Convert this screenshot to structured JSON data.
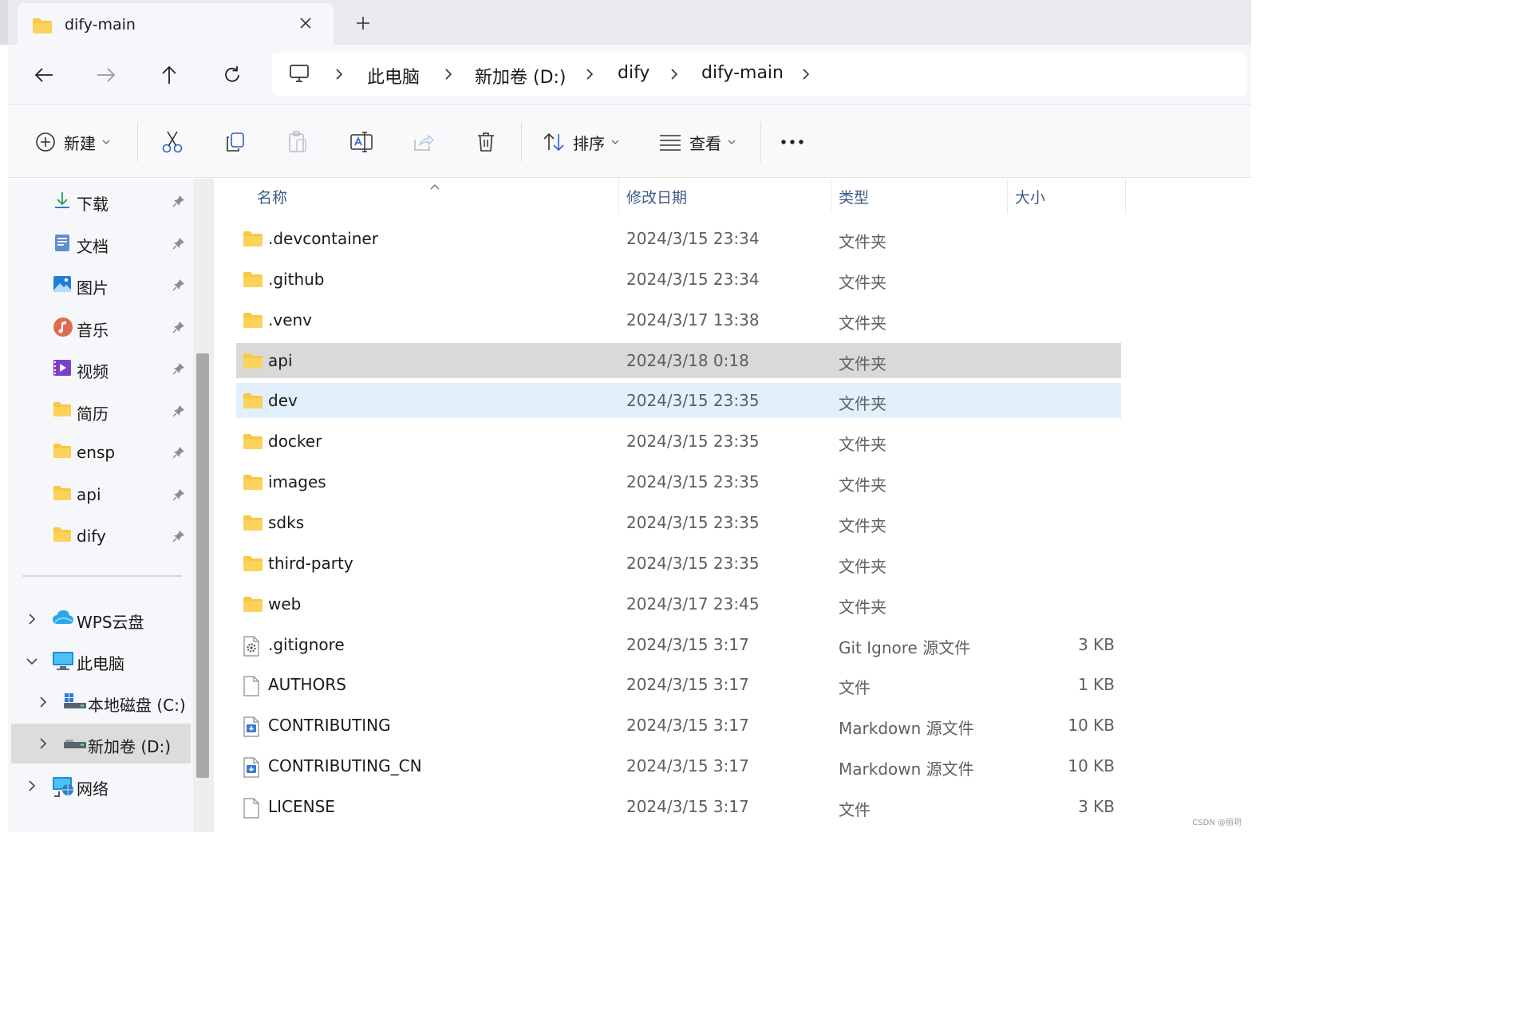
{
  "tab": {
    "title": "dify-main",
    "new_tab_symbol": "+"
  },
  "breadcrumb": [
    "此电脑",
    "新加卷 (D:)",
    "dify",
    "dify-main"
  ],
  "toolbar": {
    "new_label": "新建",
    "sort_label": "排序",
    "view_label": "查看"
  },
  "sidebar": {
    "quick_access": [
      {
        "label": "下载",
        "icon": "download-icon"
      },
      {
        "label": "文档",
        "icon": "documents-icon"
      },
      {
        "label": "图片",
        "icon": "pictures-icon"
      },
      {
        "label": "音乐",
        "icon": "music-icon"
      },
      {
        "label": "视频",
        "icon": "videos-icon"
      },
      {
        "label": "简历",
        "icon": "folder-icon"
      },
      {
        "label": "ensp",
        "icon": "folder-icon"
      },
      {
        "label": "api",
        "icon": "folder-icon"
      },
      {
        "label": "dify",
        "icon": "folder-icon"
      }
    ],
    "tree": [
      {
        "label": "WPS云盘",
        "icon": "cloud-icon",
        "expanded": false
      },
      {
        "label": "此电脑",
        "icon": "pc-icon",
        "expanded": true
      },
      {
        "label": "本地磁盘 (C:)",
        "icon": "drive-icon",
        "expanded": false
      },
      {
        "label": "新加卷 (D:)",
        "icon": "drive-icon",
        "expanded": false,
        "selected": true
      },
      {
        "label": "网络",
        "icon": "network-icon",
        "expanded": false
      }
    ]
  },
  "columns": {
    "name": "名称",
    "modified": "修改日期",
    "type": "类型",
    "size": "大小"
  },
  "files": [
    {
      "name": ".devcontainer",
      "date": "2024/3/15 23:34",
      "type": "文件夹",
      "size": "",
      "kind": "folder"
    },
    {
      "name": ".github",
      "date": "2024/3/15 23:34",
      "type": "文件夹",
      "size": "",
      "kind": "folder"
    },
    {
      "name": ".venv",
      "date": "2024/3/17 13:38",
      "type": "文件夹",
      "size": "",
      "kind": "folder"
    },
    {
      "name": "api",
      "date": "2024/3/18 0:18",
      "type": "文件夹",
      "size": "",
      "kind": "folder",
      "state": "hover"
    },
    {
      "name": "dev",
      "date": "2024/3/15 23:35",
      "type": "文件夹",
      "size": "",
      "kind": "folder",
      "state": "selected"
    },
    {
      "name": "docker",
      "date": "2024/3/15 23:35",
      "type": "文件夹",
      "size": "",
      "kind": "folder"
    },
    {
      "name": "images",
      "date": "2024/3/15 23:35",
      "type": "文件夹",
      "size": "",
      "kind": "folder"
    },
    {
      "name": "sdks",
      "date": "2024/3/15 23:35",
      "type": "文件夹",
      "size": "",
      "kind": "folder"
    },
    {
      "name": "third-party",
      "date": "2024/3/15 23:35",
      "type": "文件夹",
      "size": "",
      "kind": "folder"
    },
    {
      "name": "web",
      "date": "2024/3/17 23:45",
      "type": "文件夹",
      "size": "",
      "kind": "folder"
    },
    {
      "name": ".gitignore",
      "date": "2024/3/15 3:17",
      "type": "Git Ignore 源文件",
      "size": "3 KB",
      "kind": "gear"
    },
    {
      "name": "AUTHORS",
      "date": "2024/3/15 3:17",
      "type": "文件",
      "size": "1 KB",
      "kind": "blank"
    },
    {
      "name": "CONTRIBUTING",
      "date": "2024/3/15 3:17",
      "type": "Markdown 源文件",
      "size": "10 KB",
      "kind": "markdown"
    },
    {
      "name": "CONTRIBUTING_CN",
      "date": "2024/3/15 3:17",
      "type": "Markdown 源文件",
      "size": "10 KB",
      "kind": "markdown"
    },
    {
      "name": "LICENSE",
      "date": "2024/3/15 3:17",
      "type": "文件",
      "size": "3 KB",
      "kind": "blank"
    }
  ],
  "watermark": "CSDN @丽玥",
  "colors": {
    "folder": "#f8c843",
    "selected_row": "#e2f0fb",
    "hover_row": "#d9d9d9",
    "column_header": "#3e5b8a"
  }
}
